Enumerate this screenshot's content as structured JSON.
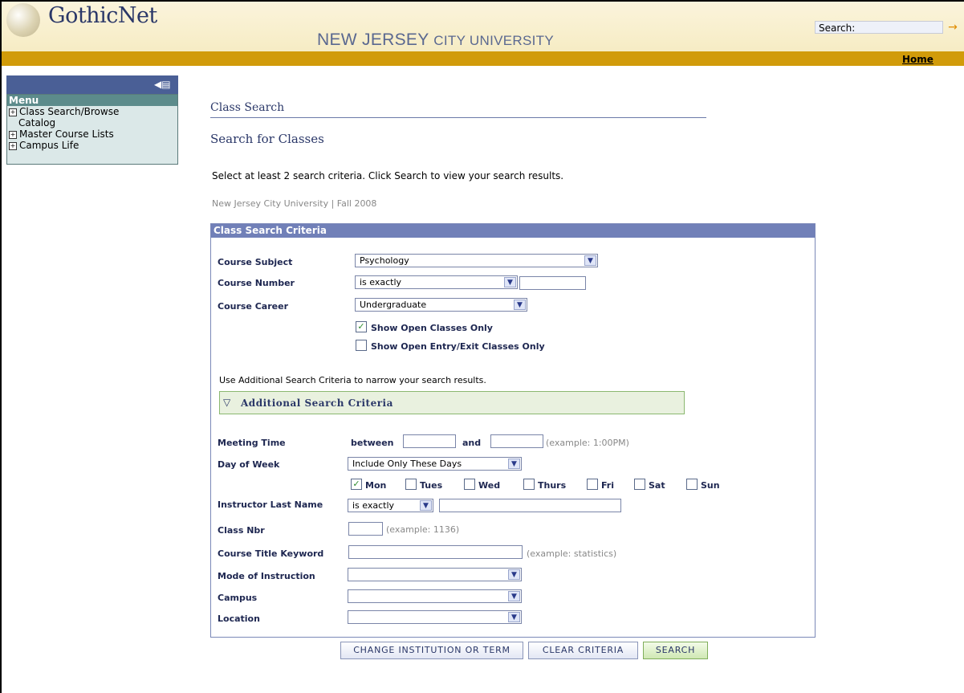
{
  "header": {
    "logo": "GothicNet",
    "university_main": "NEW JERSEY",
    "university_small": "CITY UNIVERSITY",
    "search_label": "Search:",
    "home_link": "Home"
  },
  "sidebar": {
    "menu_title": "Menu",
    "items": [
      {
        "label": "Class Search/Browse",
        "continuation": "Catalog"
      },
      {
        "label": "Master Course Lists"
      },
      {
        "label": "Campus Life"
      }
    ]
  },
  "main": {
    "page_title": "Class Search",
    "section_title": "Search for Classes",
    "instructions": "Select at least 2 search criteria. Click Search to view your search results.",
    "institution_term": "New Jersey City University | Fall 2008"
  },
  "criteria": {
    "header": "Class Search Criteria",
    "course_subject_label": "Course Subject",
    "course_subject_value": "Psychology",
    "course_number_label": "Course Number",
    "course_number_operator": "is exactly",
    "course_career_label": "Course Career",
    "course_career_value": "Undergraduate",
    "show_open_label": "Show Open Classes Only",
    "show_open_entry_label": "Show Open Entry/Exit Classes Only",
    "additional_note": "Use Additional Search Criteria to narrow your search results.",
    "additional_header": "Additional Search Criteria"
  },
  "additional": {
    "meeting_time_label": "Meeting Time",
    "between_label": "between",
    "and_label": "and",
    "time_example": "(example: 1:00PM)",
    "day_of_week_label": "Day of Week",
    "day_of_week_value": "Include Only These Days",
    "days": [
      "Mon",
      "Tues",
      "Wed",
      "Thurs",
      "Fri",
      "Sat",
      "Sun"
    ],
    "instructor_label": "Instructor Last Name",
    "instructor_operator": "is exactly",
    "class_nbr_label": "Class Nbr",
    "class_nbr_example": "(example: 1136)",
    "title_keyword_label": "Course Title Keyword",
    "title_keyword_example": "(example: statistics)",
    "mode_label": "Mode of Instruction",
    "campus_label": "Campus",
    "location_label": "Location"
  },
  "buttons": {
    "change": "CHANGE INSTITUTION OR TERM",
    "clear": "CLEAR CRITERIA",
    "search": "SEARCH"
  },
  "icons": {
    "collapse": "collapse-menu-icon",
    "search_go": "arrow-right-icon",
    "expand": "triangle-down-icon",
    "dropdown": "chevron-down-icon",
    "checkmark": "check-icon",
    "plus": "plus-box-icon"
  },
  "colors": {
    "gold_bar": "#d19b0a",
    "sidebar_top": "#4a5f96",
    "criteria_header": "#7180b8",
    "menu_head": "#5c8b8b"
  }
}
